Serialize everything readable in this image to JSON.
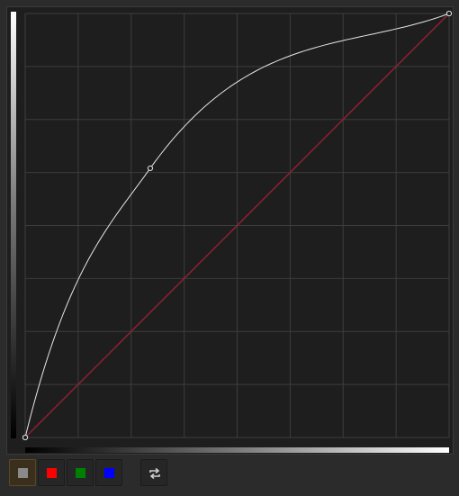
{
  "colors": {
    "background": "#2b2b2b",
    "plot_background": "#1e1e1e",
    "grid": "#3d3d3d",
    "curve": "#e6e6e6",
    "identity_line": "#8c2231",
    "control_point": "#e6e6e6"
  },
  "curve_editor": {
    "grid_divisions": 8,
    "input_range": [
      0,
      1
    ],
    "output_range": [
      0,
      1
    ],
    "identity_line": true,
    "control_points": [
      {
        "input": 0.0,
        "output": 0.0
      },
      {
        "input": 0.295,
        "output": 0.635
      },
      {
        "input": 1.0,
        "output": 1.0
      }
    ]
  },
  "channels": [
    {
      "name": "luminance",
      "color": "#8a8a8a",
      "active": true,
      "icon": "gray-square-icon"
    },
    {
      "name": "red",
      "color": "#ff0000",
      "active": false,
      "icon": "red-square-icon"
    },
    {
      "name": "green",
      "color": "#008000",
      "active": false,
      "icon": "green-square-icon"
    },
    {
      "name": "blue",
      "color": "#0000ff",
      "active": false,
      "icon": "blue-square-icon"
    }
  ],
  "reset_button": {
    "icon": "swap-arrows-icon"
  }
}
